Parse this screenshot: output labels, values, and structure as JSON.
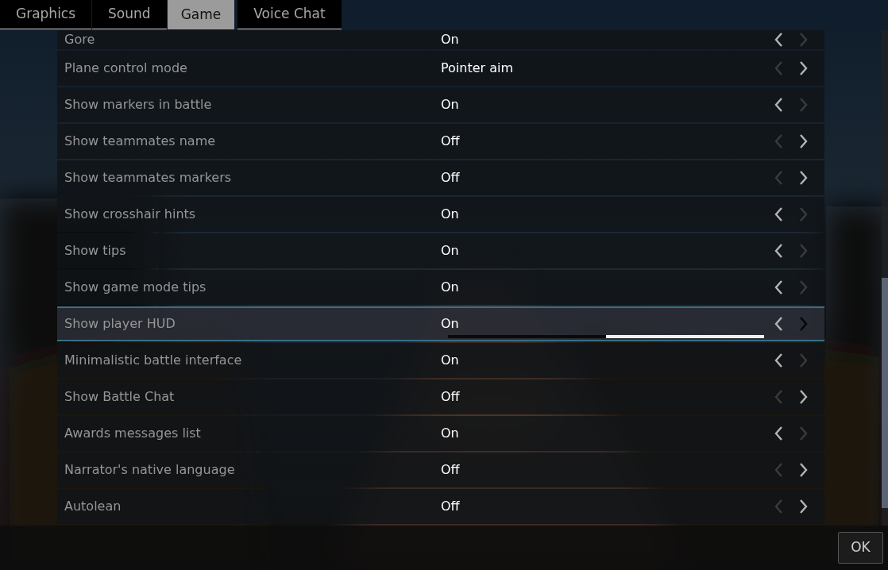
{
  "tabs": [
    {
      "label": "Graphics",
      "selected": false
    },
    {
      "label": "Sound",
      "selected": false
    },
    {
      "label": "Game",
      "selected": true
    },
    {
      "label": "Voice Chat",
      "selected": false
    }
  ],
  "settings": [
    {
      "label": "Gore",
      "value": "On",
      "selected": false,
      "prev_enabled": true,
      "next_enabled": false
    },
    {
      "label": "Plane control mode",
      "value": "Pointer aim",
      "selected": false,
      "prev_enabled": false,
      "next_enabled": true
    },
    {
      "label": "Show markers in battle",
      "value": "On",
      "selected": false,
      "prev_enabled": true,
      "next_enabled": false
    },
    {
      "label": "Show teammates name",
      "value": "Off",
      "selected": false,
      "prev_enabled": false,
      "next_enabled": true
    },
    {
      "label": "Show teammates markers",
      "value": "Off",
      "selected": false,
      "prev_enabled": false,
      "next_enabled": true
    },
    {
      "label": "Show crosshair hints",
      "value": "On",
      "selected": false,
      "prev_enabled": true,
      "next_enabled": false
    },
    {
      "label": "Show tips",
      "value": "On",
      "selected": false,
      "prev_enabled": true,
      "next_enabled": false
    },
    {
      "label": "Show game mode tips",
      "value": "On",
      "selected": false,
      "prev_enabled": true,
      "next_enabled": false
    },
    {
      "label": "Show player HUD",
      "value": "On",
      "selected": true,
      "prev_enabled": true,
      "next_enabled": false,
      "level": 0.5
    },
    {
      "label": "Minimalistic battle interface",
      "value": "On",
      "selected": false,
      "prev_enabled": true,
      "next_enabled": false
    },
    {
      "label": "Show Battle Chat",
      "value": "Off",
      "selected": false,
      "prev_enabled": false,
      "next_enabled": true
    },
    {
      "label": "Awards messages list",
      "value": "On",
      "selected": false,
      "prev_enabled": true,
      "next_enabled": false
    },
    {
      "label": "Narrator's native language",
      "value": "Off",
      "selected": false,
      "prev_enabled": false,
      "next_enabled": true
    },
    {
      "label": "Autolean",
      "value": "Off",
      "selected": false,
      "prev_enabled": false,
      "next_enabled": true
    }
  ],
  "ok_button": "OK"
}
